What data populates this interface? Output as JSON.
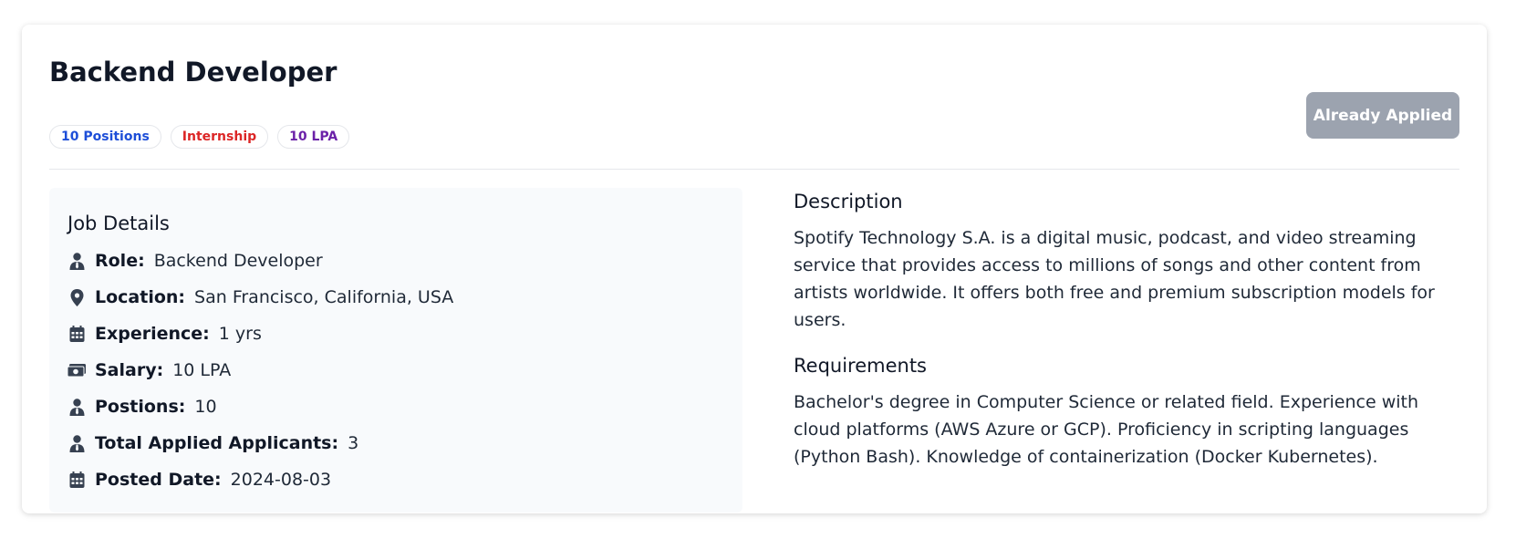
{
  "job": {
    "title": "Backend Developer",
    "badges": [
      {
        "label": "10 Positions",
        "color": "#1d4ed8"
      },
      {
        "label": "Internship",
        "color": "#dc2626"
      },
      {
        "label": "10 LPA",
        "color": "#6b21a8"
      }
    ],
    "apply_button": {
      "label": "Already Applied",
      "color": "#9ca3af",
      "disabled": true
    }
  },
  "details": {
    "heading": "Job Details",
    "rows": [
      {
        "icon": "user-tie-icon",
        "label": "Role:",
        "value": "Backend Developer"
      },
      {
        "icon": "location-pin-icon",
        "label": "Location:",
        "value": "San Francisco, California, USA"
      },
      {
        "icon": "calendar-icon",
        "label": "Experience:",
        "value": "1 yrs"
      },
      {
        "icon": "money-icon",
        "label": "Salary:",
        "value": "10 LPA"
      },
      {
        "icon": "user-tie-icon",
        "label": "Postions:",
        "value": "10"
      },
      {
        "icon": "user-tie-icon",
        "label": "Total Applied Applicants:",
        "value": "3"
      },
      {
        "icon": "calendar-icon",
        "label": "Posted Date:",
        "value": "2024-08-03"
      }
    ]
  },
  "description": {
    "heading": "Description",
    "text": "Spotify Technology S.A. is a digital music, podcast, and video streaming service that provides access to millions of songs and other content from artists worldwide. It offers both free and premium subscription models for users."
  },
  "requirements": {
    "heading": "Requirements",
    "text": "Bachelor's degree in Computer Science or related field. Experience with cloud platforms (AWS Azure or GCP). Proficiency in scripting languages (Python Bash). Knowledge of containerization (Docker Kubernetes)."
  }
}
